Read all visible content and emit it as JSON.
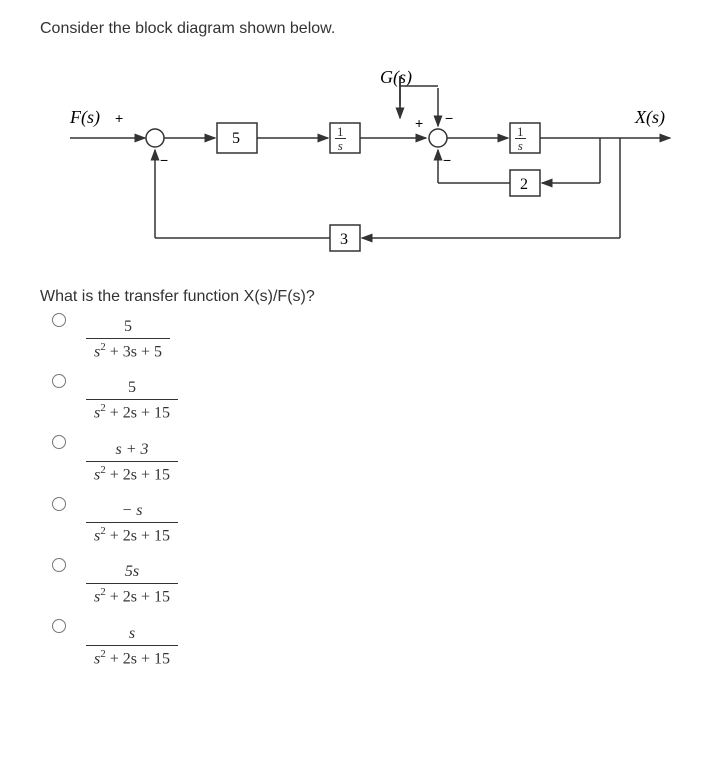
{
  "prompt": "Consider the block diagram shown below.",
  "question": "What is the transfer function X(s)/F(s)?",
  "labels": {
    "F": "F(s)",
    "G": "G(s)",
    "X": "X(s)",
    "plus1": "+",
    "minus1": "−",
    "plus2": "+",
    "minus2": "−",
    "minus3": "−"
  },
  "blocks": {
    "b1": "5",
    "b2_num": "1",
    "b2_den": "s",
    "b3_num": "1",
    "b3_den": "s",
    "b4": "2",
    "b5": "3"
  },
  "options": [
    {
      "num": "5",
      "den_a": "s",
      "den_exp": "2",
      "den_rest": " + 3s + 5"
    },
    {
      "num": "5",
      "den_a": "s",
      "den_exp": "2",
      "den_rest": " + 2s + 15"
    },
    {
      "num": "s + 3",
      "den_a": "s",
      "den_exp": "2",
      "den_rest": " + 2s + 15"
    },
    {
      "num": "− s",
      "den_a": "s",
      "den_exp": "2",
      "den_rest": " + 2s + 15"
    },
    {
      "num": "5s",
      "den_a": "s",
      "den_exp": "2",
      "den_rest": " + 2s + 15"
    },
    {
      "num": "s",
      "den_a": "s",
      "den_exp": "2",
      "den_rest": " + 2s + 15"
    }
  ]
}
